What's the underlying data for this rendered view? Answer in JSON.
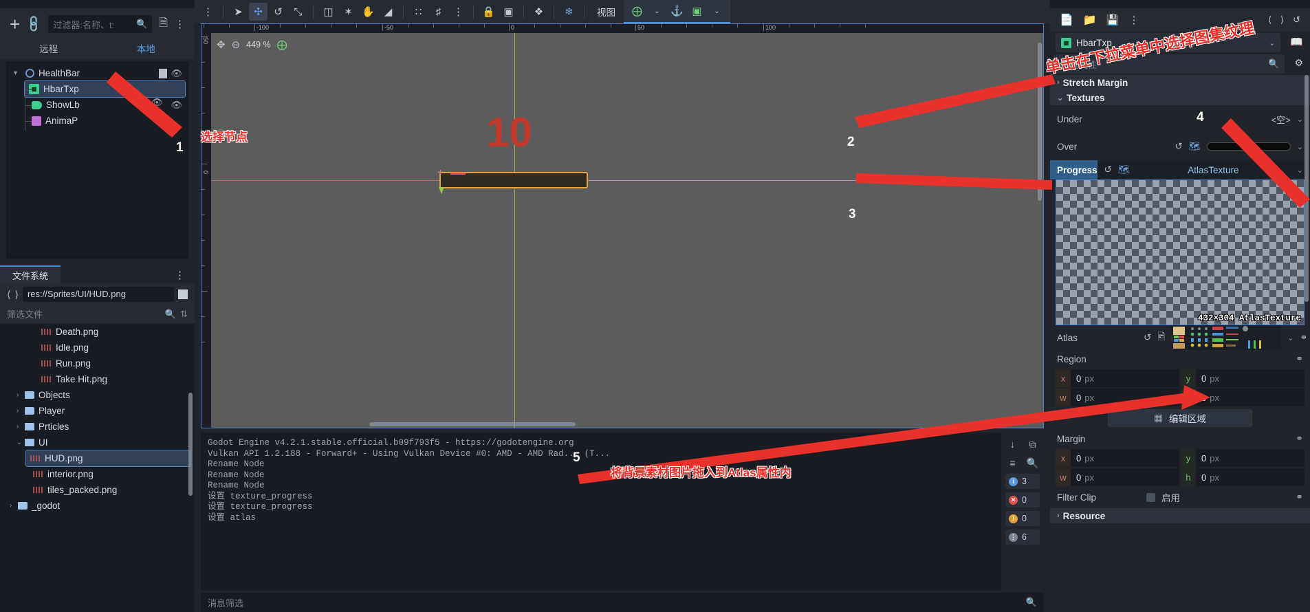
{
  "scene_panel": {
    "filter_placeholder": "过滤器:名称、t:",
    "search_icon": "search-icon",
    "add_icon": "plus-icon",
    "link_icon": "link-icon",
    "instance_icon": "instance-child-scene-icon",
    "menu_icon": "kebab-menu-icon",
    "tabs": {
      "remote": "远程",
      "local": "本地"
    },
    "tree": [
      {
        "label": "HealthBar",
        "icon": "control-node-icon",
        "depth": 0,
        "selected": false,
        "has_caret": true,
        "has_script": true,
        "has_eye": true
      },
      {
        "label": "HbarTxp",
        "icon": "texture-progress-bar-icon",
        "depth": 1,
        "selected": true,
        "has_caret": false,
        "has_script": false,
        "has_eye": true
      },
      {
        "label": "ShowLb",
        "icon": "label-icon",
        "depth": 1,
        "selected": false,
        "has_caret": false,
        "has_script": false,
        "has_eye": true
      },
      {
        "label": "AnimaP",
        "icon": "animation-player-icon",
        "depth": 1,
        "selected": false,
        "has_caret": false,
        "has_script": false,
        "has_eye": false
      }
    ]
  },
  "filesystem_panel": {
    "tab_label": "文件系统",
    "path": "res://Sprites/UI/HUD.png",
    "back_icon": "chevron-left-icon",
    "forward_icon": "chevron-right-icon",
    "toggle_split_icon": "toggle-split-mode-icon",
    "filter_placeholder": "筛选文件",
    "search_icon": "search-icon",
    "sort_icon": "sort-icon",
    "menu_icon": "kebab-menu-icon",
    "items": [
      {
        "label": "Death.png",
        "type": "file",
        "depth": 3,
        "selected": false
      },
      {
        "label": "Idle.png",
        "type": "file",
        "depth": 3,
        "selected": false
      },
      {
        "label": "Run.png",
        "type": "file",
        "depth": 3,
        "selected": false
      },
      {
        "label": "Take Hit.png",
        "type": "file",
        "depth": 3,
        "selected": false
      },
      {
        "label": "Objects",
        "type": "folder",
        "depth": 2,
        "selected": false
      },
      {
        "label": "Player",
        "type": "folder",
        "depth": 2,
        "selected": false
      },
      {
        "label": "Prticles",
        "type": "folder",
        "depth": 2,
        "selected": false
      },
      {
        "label": "UI",
        "type": "folder",
        "depth": 2,
        "selected": false,
        "expanded": true
      },
      {
        "label": "HUD.png",
        "type": "file",
        "depth": 3,
        "selected": true
      },
      {
        "label": "interior.png",
        "type": "file",
        "depth": 3,
        "selected": false
      },
      {
        "label": "tiles_packed.png",
        "type": "file",
        "depth": 3,
        "selected": false
      },
      {
        "label": "_godot",
        "type": "folder",
        "depth": 1,
        "selected": false
      }
    ]
  },
  "viewport_toolbar": {
    "menu_icon": "kebab-menu-icon",
    "tools": [
      {
        "name": "select-mode-icon",
        "glyph": "➤",
        "active": false
      },
      {
        "name": "move-mode-icon",
        "glyph": "✥",
        "active": true
      },
      {
        "name": "rotate-mode-icon",
        "glyph": "↺",
        "active": false
      },
      {
        "name": "scale-mode-icon",
        "glyph": "⤡",
        "active": false
      },
      {
        "name": "list-select-icon",
        "glyph": "☰",
        "active": false
      },
      {
        "name": "pivot-mode-icon",
        "glyph": "✶",
        "active": false
      },
      {
        "name": "pan-mode-icon",
        "glyph": "✋",
        "active": false
      },
      {
        "name": "ruler-mode-icon",
        "glyph": "◢",
        "active": false
      },
      {
        "name": "snap-mode-icon",
        "glyph": "⌇",
        "active": false
      },
      {
        "name": "grid-snap-icon",
        "glyph": "⌗",
        "active": false
      },
      {
        "name": "snap-options-icon",
        "glyph": "⋮",
        "active": false
      },
      {
        "name": "lock-icon",
        "glyph": "🔒",
        "active": false
      },
      {
        "name": "group-icon",
        "glyph": "⬚",
        "active": false
      },
      {
        "name": "skeleton-icon",
        "glyph": "🦴",
        "active": false
      },
      {
        "name": "bone-options-icon",
        "glyph": "❦",
        "active": false
      }
    ],
    "view_label": "视图",
    "right_tools": [
      {
        "name": "add-anchor-icon",
        "glyph": "⊕"
      },
      {
        "name": "anchor-preset-icon",
        "glyph": "⚓"
      },
      {
        "name": "layout-preset-icon",
        "glyph": "⬚"
      }
    ]
  },
  "viewport": {
    "zoom_value": "449 %",
    "zoom_reset_icon": "zoom-reset-icon",
    "zoom_out_icon": "zoom-out-icon",
    "zoom_in_icon": "zoom-in-icon",
    "ruler_labels_h": [
      "-100",
      "-50",
      "0",
      "50",
      "100"
    ],
    "ruler_labels_v": [
      "50",
      "0"
    ],
    "canvas_text": "10"
  },
  "annotations": [
    {
      "num": "1",
      "text": "选择节点",
      "name": "annotation-1-select-node"
    },
    {
      "num": "2",
      "text": "",
      "name": "annotation-2-textures"
    },
    {
      "num": "3",
      "text": "",
      "name": "annotation-3-progress"
    },
    {
      "num": "4",
      "text": "",
      "name": "annotation-4-atlas-dropdown"
    },
    {
      "num": "5",
      "text": "将背景素材图片拖入到Atlas属性内",
      "name": "annotation-5-drag-atlas"
    }
  ],
  "annotation_top_text": "单击在下拉菜单中选择图集纹理",
  "log": {
    "lines": [
      "Godot Engine v4.2.1.stable.official.b09f793f5 - https://godotengine.org",
      "Vulkan API 1.2.188 - Forward+ - Using Vulkan Device #0: AMD - AMD Rad... (T...",
      "",
      "Rename Node",
      "Rename Node",
      "Rename Node",
      "设置 texture_progress",
      "设置 texture_progress",
      "设置 atlas"
    ],
    "side_icons": [
      {
        "name": "expand-output-icon",
        "glyph": "⤓"
      },
      {
        "name": "copy-output-icon",
        "glyph": "⧉"
      },
      {
        "name": "filter-messages-icon",
        "glyph": "☲"
      },
      {
        "name": "search-output-icon",
        "glyph": "🔍"
      }
    ],
    "badges": [
      {
        "name": "info-badge",
        "count": "3",
        "color": "#5b9ae0",
        "glyph": "i"
      },
      {
        "name": "error-badge",
        "count": "0",
        "color": "#e0514b",
        "glyph": "×"
      },
      {
        "name": "warning-badge",
        "count": "0",
        "color": "#e0a33a",
        "glyph": "!"
      },
      {
        "name": "editor-message-badge",
        "count": "6",
        "color": "#7b8495",
        "glyph": "ℹ"
      }
    ],
    "filter_placeholder": "消息筛选",
    "search_icon": "search-icon"
  },
  "inspector": {
    "new_resource_icon": "new-resource-icon",
    "load_icon": "folder-open-icon",
    "save_icon": "save-icon",
    "menu_icon": "kebab-menu-icon",
    "history_back_icon": "chevron-left-icon",
    "history_forward_icon": "chevron-right-icon",
    "history_icon": "history-icon",
    "doc_icon": "open-docs-icon",
    "settings_icon": "inspector-settings-icon",
    "object_name": "HbarTxp",
    "object_icon": "texture-progress-bar-icon",
    "filter_placeholder": "筛选属性",
    "search_icon": "search-icon",
    "sections": [
      {
        "label": "Stretch Margin",
        "expanded": false,
        "name": "section-stretch-margin"
      },
      {
        "label": "Textures",
        "expanded": true,
        "name": "section-textures"
      }
    ],
    "texture_rows": [
      {
        "label": "Under",
        "value": "<空>",
        "name": "property-under",
        "has_revert": false,
        "has_quickload": false,
        "swatch": false
      },
      {
        "label": "Over",
        "value": "",
        "name": "property-over",
        "has_revert": true,
        "has_quickload": true,
        "swatch": true
      }
    ],
    "progress": {
      "label": "Progress",
      "type_label": "AtlasTexture",
      "revert_icon": "revert-icon",
      "quickload_icon": "quick-load-icon",
      "preview_label": "432×304 AtlasTexture"
    },
    "atlas_row": {
      "label": "Atlas",
      "revert_icon": "revert-icon",
      "quickload_icon": "quick-load-icon",
      "key_icon": "keyframe-icon"
    },
    "region": {
      "label": "Region",
      "key_icon": "keyframe-icon",
      "fields": [
        {
          "key": "x",
          "value": "0",
          "unit": "px"
        },
        {
          "key": "y",
          "value": "0",
          "unit": "px"
        },
        {
          "key": "w",
          "value": "0",
          "unit": "px"
        },
        {
          "key": "h",
          "value": "0",
          "unit": "px"
        }
      ],
      "edit_button": "编辑区域",
      "edit_button_icon": "region-edit-icon"
    },
    "margin": {
      "label": "Margin",
      "key_icon": "keyframe-icon",
      "fields": [
        {
          "key": "x",
          "value": "0",
          "unit": "px"
        },
        {
          "key": "y",
          "value": "0",
          "unit": "px"
        },
        {
          "key": "w",
          "value": "0",
          "unit": "px"
        },
        {
          "key": "h",
          "value": "0",
          "unit": "px"
        }
      ]
    },
    "filter_clip": {
      "label": "Filter Clip",
      "checkbox_label": "启用",
      "checked": false,
      "key_icon": "keyframe-icon"
    },
    "resource_section": {
      "label": "Resource",
      "expanded": false
    }
  },
  "colors": {
    "accent": "#4d90d8",
    "selection": "#33405a",
    "annotation_red": "#e8312a",
    "panel_bg": "#21242b",
    "dark_bg": "#191c22"
  }
}
